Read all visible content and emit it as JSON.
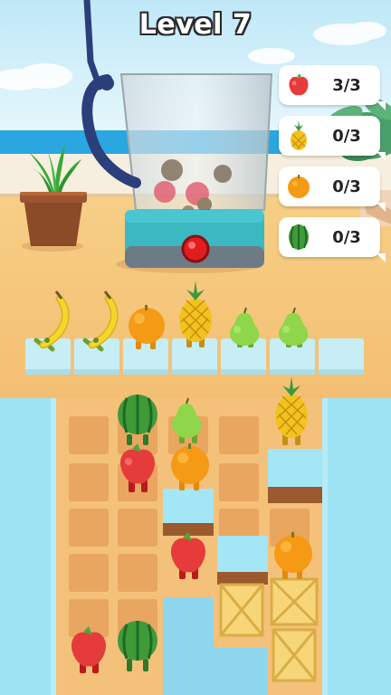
{
  "hud": {
    "level_label": "Level 7"
  },
  "goals": [
    {
      "fruit": "apple-icon",
      "count": "3/3",
      "color": "#e53b3b"
    },
    {
      "fruit": "pineapple-icon",
      "count": "0/3",
      "color": "#f2c21e"
    },
    {
      "fruit": "orange-icon",
      "count": "0/3",
      "color": "#f59a14"
    },
    {
      "fruit": "watermelon-icon",
      "count": "0/3",
      "color": "#3f9a3a"
    }
  ],
  "slots": [
    "banana",
    "banana",
    "orange",
    "pineapple",
    "pear",
    "pear",
    "empty"
  ],
  "colors": {
    "sky": "#8fd6ef",
    "sea": "#2aa6e0",
    "floor": "#f4c17a",
    "tile": "#e9a660",
    "wall": "#9de3f4",
    "blender_base": "#3bb8c2",
    "button": "#e11d1d"
  }
}
